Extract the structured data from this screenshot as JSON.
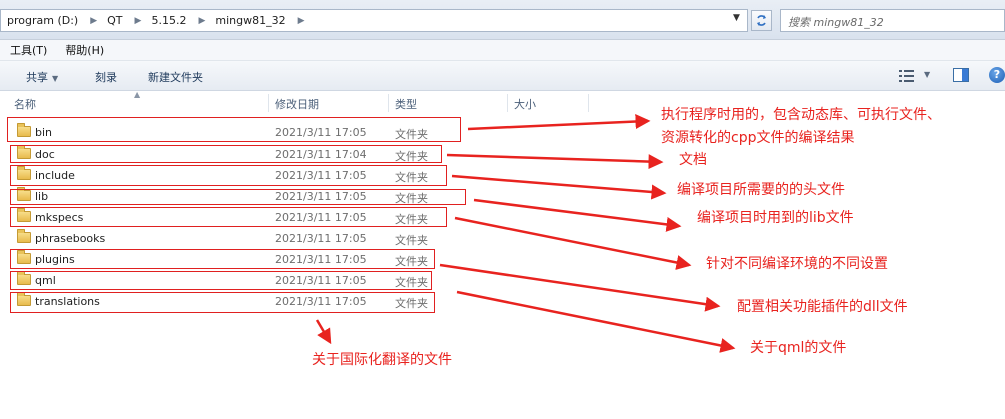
{
  "address": {
    "crumbs": [
      "program (D:)",
      "QT",
      "5.15.2",
      "mingw81_32"
    ],
    "search_placeholder": "搜索 mingw81_32"
  },
  "menu": {
    "items": [
      "工具(T)",
      "帮助(H)"
    ]
  },
  "toolbar": {
    "share_label": "共享",
    "burn_label": "刻录",
    "new_folder_label": "新建文件夹"
  },
  "columns": {
    "name": "名称",
    "date": "修改日期",
    "type": "类型",
    "size": "大小"
  },
  "files": [
    {
      "name": "bin",
      "date": "2021/3/11 17:05",
      "type": "文件夹"
    },
    {
      "name": "doc",
      "date": "2021/3/11 17:04",
      "type": "文件夹"
    },
    {
      "name": "include",
      "date": "2021/3/11 17:05",
      "type": "文件夹"
    },
    {
      "name": "lib",
      "date": "2021/3/11 17:05",
      "type": "文件夹"
    },
    {
      "name": "mkspecs",
      "date": "2021/3/11 17:05",
      "type": "文件夹"
    },
    {
      "name": "phrasebooks",
      "date": "2021/3/11 17:05",
      "type": "文件夹"
    },
    {
      "name": "plugins",
      "date": "2021/3/11 17:05",
      "type": "文件夹"
    },
    {
      "name": "qml",
      "date": "2021/3/11 17:05",
      "type": "文件夹"
    },
    {
      "name": "translations",
      "date": "2021/3/11 17:05",
      "type": "文件夹"
    }
  ],
  "annotations": {
    "bin_line1": "执行程序时用的，包含动态库、可执行文件、",
    "bin_line2": "资源转化的cpp文件的编译结果",
    "doc": "文档",
    "include": "编译项目所需要的的头文件",
    "lib": "编译项目时用到的lib文件",
    "mkspecs": "针对不同编译环境的不同设置",
    "plugins": "配置相关功能插件的dll文件",
    "qml": "关于qml的文件",
    "translations": "关于国际化翻译的文件"
  },
  "colors": {
    "annotation_red": "#e8231f",
    "folder_yellow": "#e8bb4d",
    "toolbar_text": "#1e395b"
  }
}
